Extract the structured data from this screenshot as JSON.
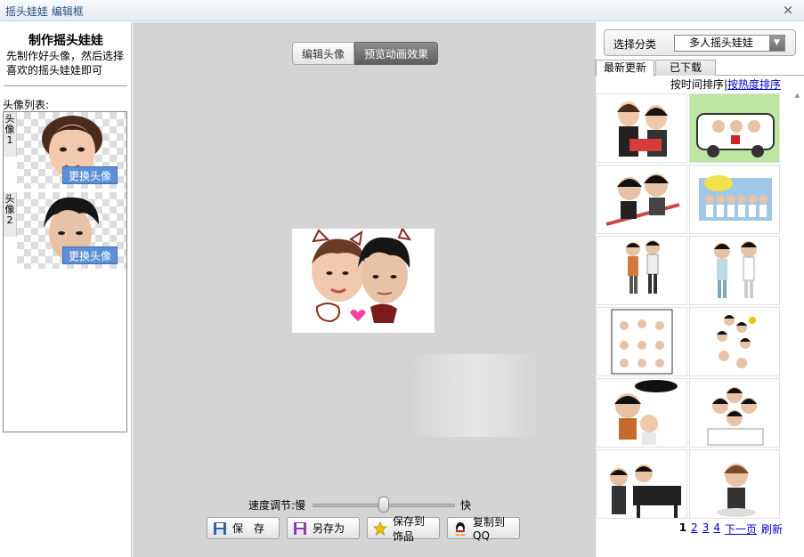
{
  "window": {
    "title": "摇头娃娃 编辑框",
    "close_glyph": "×"
  },
  "left": {
    "heading": "制作摇头娃娃",
    "description": "先制作好头像，然后选择喜欢的摇头娃娃即可",
    "list_label": "头像列表:",
    "heads": [
      {
        "tag": "头像1",
        "replace_label": "更换头像"
      },
      {
        "tag": "头像2",
        "replace_label": "更换头像"
      }
    ]
  },
  "center": {
    "tabs": [
      {
        "label": "编辑头像",
        "active": false
      },
      {
        "label": "预览动画效果",
        "active": true
      }
    ],
    "speed": {
      "label": "速度调节:慢",
      "fast_label": "快",
      "value": 0.5
    },
    "buttons": [
      {
        "label": "保　存",
        "icon": "floppy-disk-icon"
      },
      {
        "label": "另存为",
        "icon": "floppy-disk-icon"
      },
      {
        "label": "保存到饰品",
        "icon": "star-icon"
      },
      {
        "label": "复制到QQ",
        "icon": "qq-penguin-icon"
      }
    ]
  },
  "right": {
    "category_label": "选择分类",
    "category_value": "多人摇头娃娃",
    "tabs": [
      {
        "label": "最新更新",
        "active": true
      },
      {
        "label": "已下载",
        "active": false
      }
    ],
    "sort_time": "按时间排序",
    "sort_sep": "|",
    "sort_hot": "按热度排序",
    "pager": {
      "current": "1",
      "pages": [
        "2",
        "3",
        "4"
      ],
      "next": "下一页",
      "refresh": "刷新"
    }
  },
  "colors": {
    "accent": "#5b8fd6",
    "link": "#0000cc",
    "center_bg": "#d4d4d4"
  }
}
